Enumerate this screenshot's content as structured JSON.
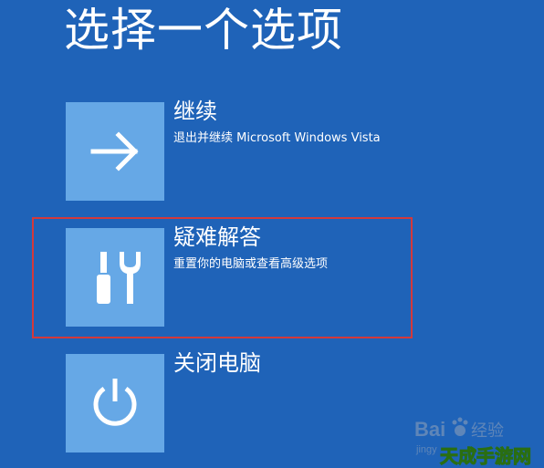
{
  "page": {
    "title": "选择一个选项"
  },
  "options": [
    {
      "title": "继续",
      "description": "退出并继续 Microsoft Windows Vista",
      "icon": "arrow-right-icon"
    },
    {
      "title": "疑难解答",
      "description": "重置你的电脑或查看高级选项",
      "icon": "tools-icon"
    },
    {
      "title": "关闭电脑",
      "description": "",
      "icon": "power-icon"
    }
  ],
  "colors": {
    "background": "#1f63b8",
    "tile": "#66a8e6",
    "text": "#ffffff",
    "highlight_border": "#d3393b"
  },
  "watermark": {
    "baidu_text": "Bai",
    "experience_text": "经验",
    "site_text": "jingy",
    "game_site_text": "天成手游网"
  }
}
